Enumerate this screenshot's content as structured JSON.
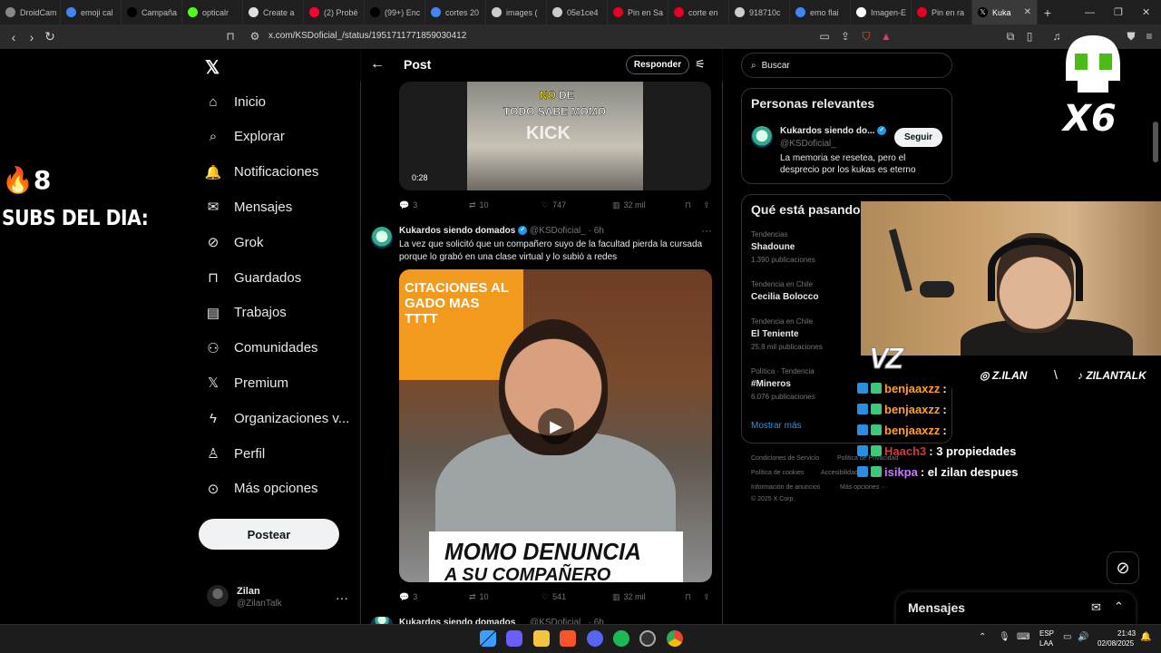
{
  "browser": {
    "tabs": [
      {
        "label": "DroidCam",
        "color": "#888888"
      },
      {
        "label": "emoji cal",
        "color": "#4285f4"
      },
      {
        "label": "Campaña",
        "color": "#000000"
      },
      {
        "label": "opticalr",
        "color": "#53fc18"
      },
      {
        "label": "Create a",
        "color": "#e0e0e0"
      },
      {
        "label": "(2) Probé",
        "color": "#ff0033"
      },
      {
        "label": "(99+) Enc",
        "color": "#000000"
      },
      {
        "label": "cortes 20",
        "color": "#4285f4"
      },
      {
        "label": "images (",
        "color": "#cccccc"
      },
      {
        "label": "05e1ce4",
        "color": "#cccccc"
      },
      {
        "label": "Pin en Sa",
        "color": "#e60023"
      },
      {
        "label": "corte en",
        "color": "#e60023"
      },
      {
        "label": "918710c",
        "color": "#cccccc"
      },
      {
        "label": "emo flai",
        "color": "#4285f4"
      },
      {
        "label": "Imagen-E",
        "color": "#ffffff"
      },
      {
        "label": "Pin en ra",
        "color": "#e60023"
      }
    ],
    "active_tab": "Kuka",
    "url": "x.com/KSDoficial_/status/1951711771859030412"
  },
  "stream_overlay": {
    "fire_count": "🔥8",
    "subs_label": "SUBS DEL DIA:",
    "skull_multiplier": "X6",
    "social_instagram": "Z.ILAN",
    "social_separator": "\\",
    "social_tiktok": "ZILANTALK",
    "chat": [
      {
        "user": "benjaaxzz",
        "msg": ":",
        "user_color": "#ff9f2a"
      },
      {
        "user": "benjaaxzz",
        "msg": ":",
        "user_color": "#ff9f2a"
      },
      {
        "user": "benjaaxzz",
        "msg": ":",
        "user_color": "#ff9f2a"
      },
      {
        "user": "Haach3",
        "msg": ": 3 propiedades",
        "user_color": "#d4383f"
      },
      {
        "user": "isikpa",
        "msg": ": el zilan despues",
        "user_color": "#c67cff"
      }
    ]
  },
  "nav": {
    "items": [
      {
        "label": "Inicio",
        "icon": "home-icon"
      },
      {
        "label": "Explorar",
        "icon": "search-icon"
      },
      {
        "label": "Notificaciones",
        "icon": "bell-icon"
      },
      {
        "label": "Mensajes",
        "icon": "mail-icon"
      },
      {
        "label": "Grok",
        "icon": "grok-icon"
      },
      {
        "label": "Guardados",
        "icon": "bookmark-icon"
      },
      {
        "label": "Trabajos",
        "icon": "briefcase-icon"
      },
      {
        "label": "Comunidades",
        "icon": "people-icon"
      },
      {
        "label": "Premium",
        "icon": "x-logo-icon"
      },
      {
        "label": "Organizaciones v...",
        "icon": "lightning-icon"
      },
      {
        "label": "Perfil",
        "icon": "person-icon"
      },
      {
        "label": "Más opciones",
        "icon": "more-circle-icon"
      }
    ],
    "post_button": "Postear",
    "user_name": "Zilan",
    "user_handle": "@ZilanTalk"
  },
  "center": {
    "title": "Post",
    "reply_button": "Responder",
    "media1": {
      "caption_no": "NO",
      "caption_de": "DE",
      "caption_line2": "TODO SABE MOMO",
      "caption_line3": "KICK",
      "duration": "0:28"
    },
    "actions1": {
      "replies": "3",
      "reposts": "10",
      "likes": "747",
      "views": "32 mil"
    },
    "tweet": {
      "name": "Kukardos siendo domados",
      "handle": "@KSDoficial_ · 6h",
      "text": "La vez que solicitó que un compañero suyo de la facultad pierda la cursada porque lo grabó en una clase virtual y lo subió a redes",
      "poster_text": "CITACIONES AL\nGADO MAS\nTTTT",
      "caption_line1": "MOMO DENUNCIA",
      "caption_line2": "A SU COMPAÑERO"
    },
    "actions2": {
      "replies": "3",
      "reposts": "10",
      "likes": "541",
      "views": "32 mil"
    },
    "next_tweet": {
      "name": "Kukardos siendo domados",
      "handle": "@KSDoficial_ · 6h"
    }
  },
  "right": {
    "search_placeholder": "Buscar",
    "relevant_title": "Personas relevantes",
    "relevant_name": "Kukardos siendo do...",
    "relevant_handle": "@KSDoficial_",
    "follow_button": "Seguir",
    "relevant_bio": "La memoria se resetea, pero el desprecio por los kukas es eterno",
    "trends_title": "Qué está pasando",
    "trends": [
      {
        "context": "Tendencias",
        "name": "Shadoune",
        "count": "1.390 publicaciones"
      },
      {
        "context": "Tendencia en Chile",
        "name": "Cecilia Bolocco",
        "count": ""
      },
      {
        "context": "Tendencia en Chile",
        "name": "El Teniente",
        "count": "25,8 mil publicaciones"
      },
      {
        "context": "Política · Tendencia",
        "name": "#Mineros",
        "count": "6.076 publicaciones"
      }
    ],
    "show_more": "Mostrar más",
    "footer": {
      "terms": "Condiciones de Servicio",
      "privacy": "Política de Privacidad",
      "cookies": "Política de cookies",
      "accessibility": "Accesibilidad",
      "ads": "Información de anuncios",
      "more": "Más opciones ···",
      "copyright": "© 2025 X Corp."
    },
    "messages_title": "Mensajes"
  },
  "taskbar": {
    "lang_line1": "ESP",
    "lang_line2": "LAA",
    "time": "21:43",
    "date": "02/08/2025"
  },
  "colors": {
    "accent": "#1d9bf0",
    "background": "#000000",
    "border": "#2f3336",
    "muted": "#71767b"
  }
}
